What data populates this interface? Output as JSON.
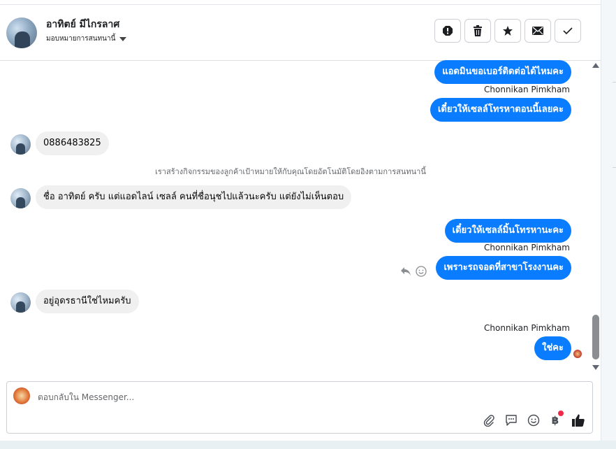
{
  "header": {
    "contact_name": "อาทิตย์ มีไกรลาศ",
    "assign_label": "มอบหมายการสนทนานี้",
    "actions": [
      "spam-icon",
      "trash-icon",
      "star-icon",
      "envelope-icon",
      "check-icon"
    ]
  },
  "thread": {
    "messages": [
      {
        "direction": "out",
        "text": "แอดมินขอเบอร์ติดต่อได้ไหมคะ"
      },
      {
        "direction": "out",
        "sender": "Chonnikan Pimkham",
        "text": "เดี๋ยวให้เซลล์โทรหาตอนนี้เลยคะ"
      },
      {
        "direction": "in",
        "text": "0886483825"
      },
      {
        "direction": "system",
        "text": "เราสร้างกิจกรรมของลูกค้าเป้าหมายให้กับคุณโดยอัตโนมัติโดยอิงตามการสนทนานี้"
      },
      {
        "direction": "in",
        "text": "ชื่อ อาทิตย์ ครับ แต่แอดไลน์ เซลล์ คนที่ชื่อนุชไปแล้วนะครับ แต่ยังไม่เห็นตอบ"
      },
      {
        "direction": "out",
        "text": "เดี๋ยวให้เซลล์มิ้นโทรหานะคะ"
      },
      {
        "direction": "out",
        "sender": "Chonnikan Pimkham",
        "text": "เพราะรถจอดที่สาขาโรงงานคะ"
      },
      {
        "direction": "in",
        "text": "อยู่อุดรธานีใช่ไหมครับ"
      },
      {
        "direction": "out",
        "sender": "Chonnikan Pimkham",
        "text": "ใช่คะ"
      }
    ]
  },
  "composer": {
    "placeholder": "ตอบกลับใน Messenger...",
    "icons": [
      "attachment-icon",
      "saved-reply-icon",
      "emoji-icon",
      "payment-icon",
      "thumbs-up-icon"
    ]
  },
  "colors": {
    "outgoing_bubble": "#0a7cff",
    "incoming_bubble": "#f0f0f0",
    "notification_dot": "#f02849"
  }
}
